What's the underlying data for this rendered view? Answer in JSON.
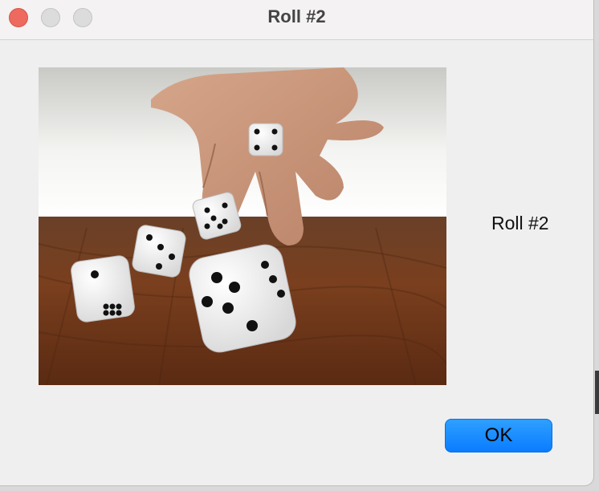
{
  "window": {
    "title": "Roll #2"
  },
  "content": {
    "label": "Roll #2",
    "image_icon": "dice-photo-icon"
  },
  "buttons": {
    "ok_label": "OK"
  },
  "colors": {
    "close": "#ee6a5e",
    "accent": "#0a7cff",
    "window_bg": "#efefef"
  }
}
